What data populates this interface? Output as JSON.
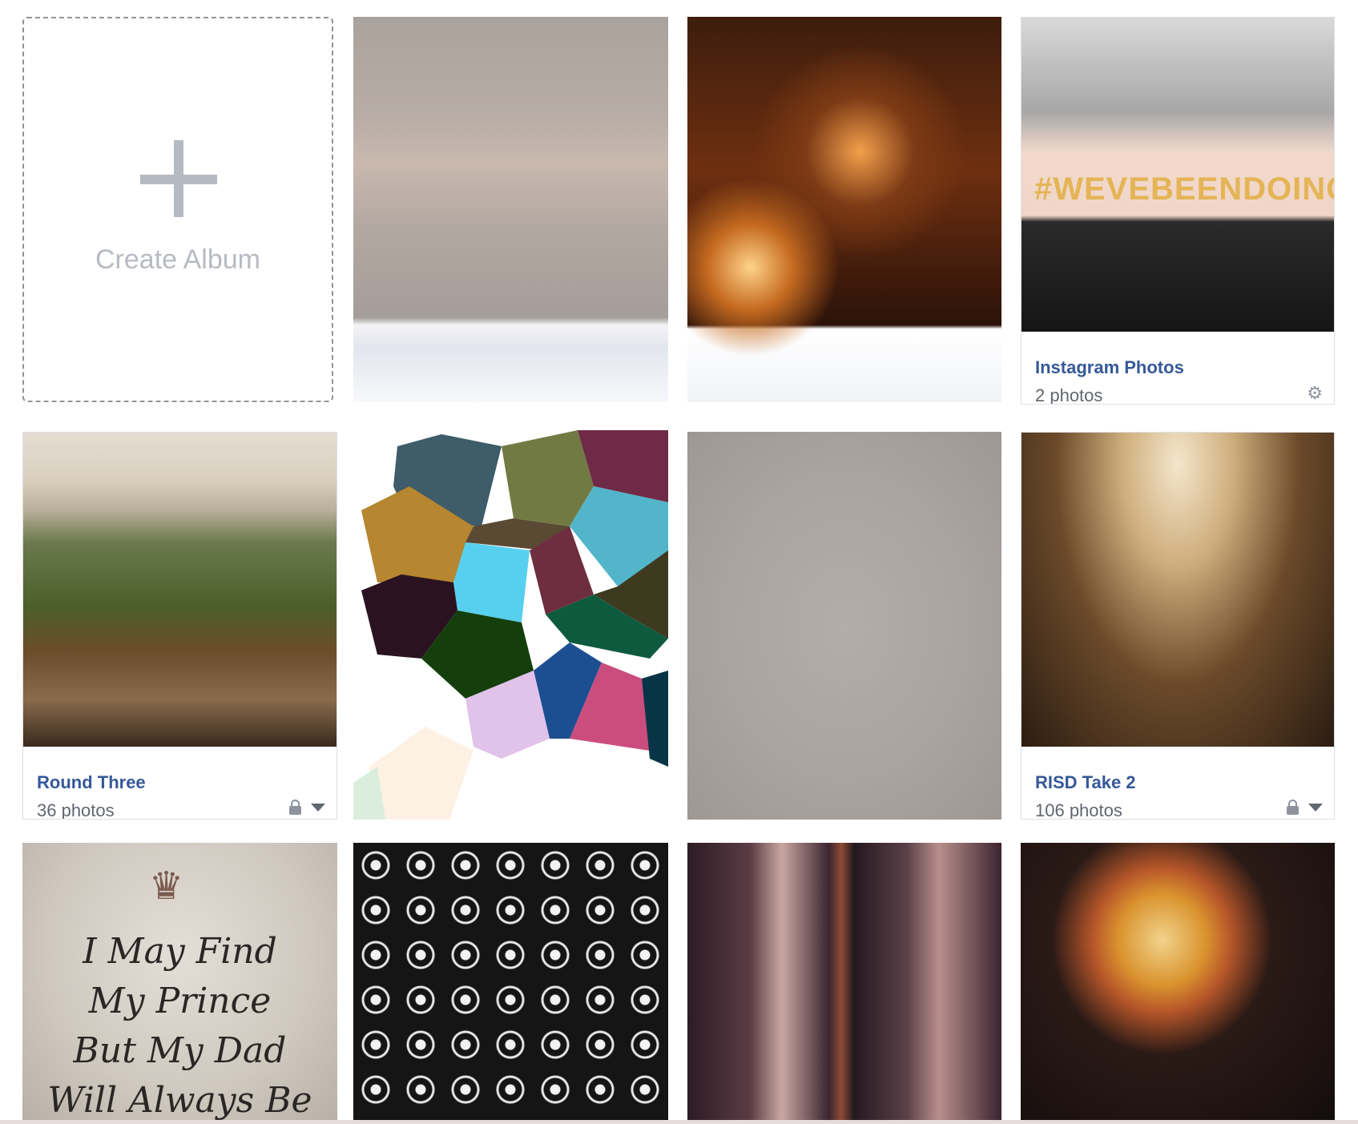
{
  "create_album": {
    "label": "Create Album",
    "icon": "plus-icon"
  },
  "albums": [
    {
      "title": "Instagram Photos",
      "count": "2 photos",
      "icon": "gear-icon"
    },
    {
      "title": "Round Three",
      "count": "36 photos",
      "privacy": "lock-icon",
      "menu": "chevron-down-icon"
    },
    {
      "title": "RISD Take 2",
      "count": "106 photos",
      "privacy": "lock-icon",
      "menu": "chevron-down-icon"
    }
  ],
  "cover_texts": {
    "hashtag": "#WEVEBEENDOINGIT",
    "quote_lines": [
      "I May Find",
      "My Prince",
      "But My Dad",
      "Will Always Be"
    ]
  },
  "colors": {
    "link": "#365899",
    "muted": "#616770",
    "plus": "#b5b9c1"
  }
}
